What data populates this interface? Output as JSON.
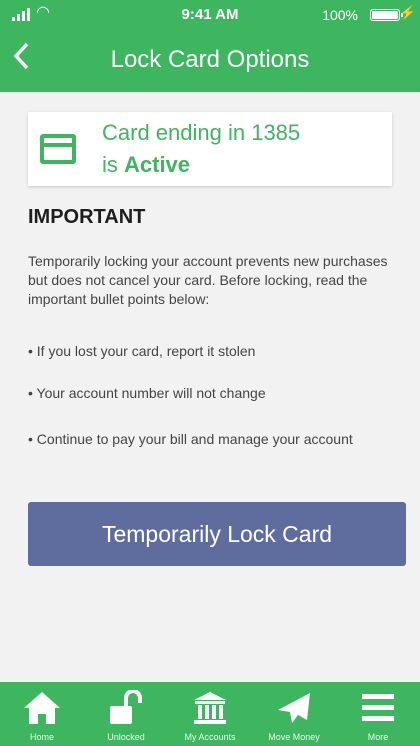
{
  "status_bar": {
    "time": "9:41 AM",
    "battery": "100%"
  },
  "nav": {
    "title": "Lock Card Options",
    "back_icon": "chevron-left-icon"
  },
  "card_status": {
    "line1": "Card ending in 1385",
    "line2_prefix": "is ",
    "line2_status": "Active",
    "icon": "credit-card-icon"
  },
  "important": {
    "heading": "IMPORTANT",
    "intro": "Temporarily locking your account prevents new purchases but does not cancel your card. Before locking, read the important bullet points below:",
    "bullets": [
      "• If you lost your card, report it stolen",
      "• Your account number will not change",
      "• Continue to pay your bill and manage your account"
    ]
  },
  "lock_button": {
    "label": "Temporarily Lock Card"
  },
  "tabs": [
    {
      "label": "Home",
      "icon": "home-icon"
    },
    {
      "label": "Unlocked",
      "icon": "unlocked-padlock-icon"
    },
    {
      "label": "My Accounts",
      "icon": "bank-icon"
    },
    {
      "label": "Move Money",
      "icon": "paper-plane-icon"
    },
    {
      "label": "More",
      "icon": "menu-icon"
    }
  ],
  "colors": {
    "brand_green": "#3eb55f",
    "button_blue": "#5f6d9e",
    "background": "#f2f2f2"
  }
}
